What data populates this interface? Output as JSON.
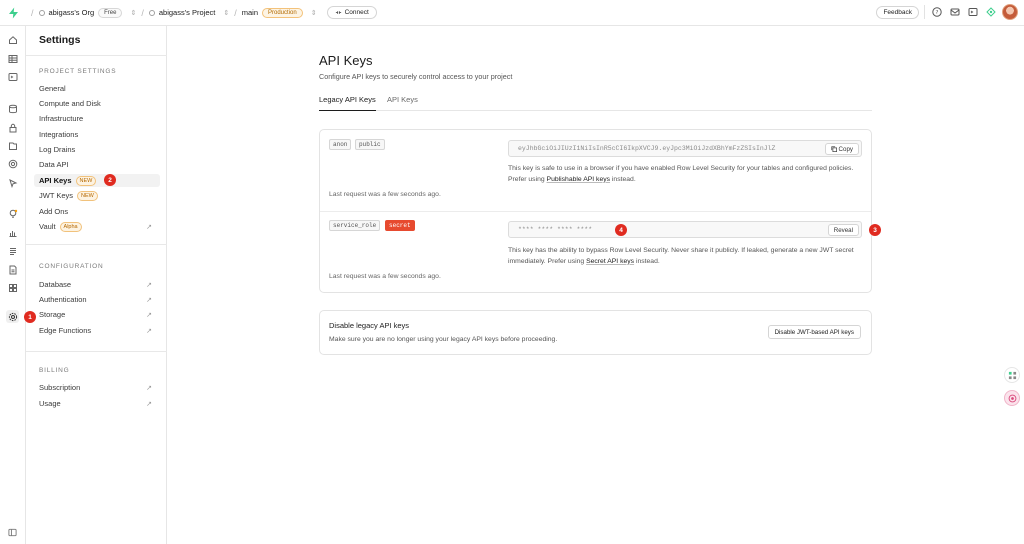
{
  "topbar": {
    "org_name": "abigass's Org",
    "org_plan": "Free",
    "project_name": "abigass's Project",
    "branch": "main",
    "branch_env": "Production",
    "connect_label": "Connect",
    "feedback_label": "Feedback"
  },
  "sidebar": {
    "title": "Settings",
    "project_settings_title": "PROJECT SETTINGS",
    "project_items": [
      {
        "label": "General"
      },
      {
        "label": "Compute and Disk"
      },
      {
        "label": "Infrastructure"
      },
      {
        "label": "Integrations"
      },
      {
        "label": "Log Drains"
      },
      {
        "label": "Data API"
      },
      {
        "label": "API Keys",
        "tag": "NEW"
      },
      {
        "label": "JWT Keys",
        "tag": "NEW"
      },
      {
        "label": "Add Ons"
      },
      {
        "label": "Vault",
        "tag": "Alpha"
      }
    ],
    "configuration_title": "CONFIGURATION",
    "configuration_items": [
      {
        "label": "Database"
      },
      {
        "label": "Authentication"
      },
      {
        "label": "Storage"
      },
      {
        "label": "Edge Functions"
      }
    ],
    "billing_title": "BILLING",
    "billing_items": [
      {
        "label": "Subscription"
      },
      {
        "label": "Usage"
      }
    ]
  },
  "markers": [
    "1",
    "2",
    "3",
    "4"
  ],
  "main": {
    "title": "API Keys",
    "subtitle": "Configure API keys to securely control access to your project",
    "tabs": [
      {
        "label": "Legacy API Keys"
      },
      {
        "label": "API Keys"
      }
    ],
    "anon": {
      "badge1": "anon",
      "badge2": "public",
      "key_value": "eyJhbGciOiJIUzI1NiIsInR5cCI6IkpXVCJ9.eyJpc3MiOiJzdXBhYmFzZSIsInJlZ",
      "copy_label": "Copy",
      "note_pre": "This key is safe to use in a browser if you have enabled Row Level Security for your tables and configured policies. Prefer using ",
      "note_link": "Publishable API keys",
      "note_post": " instead.",
      "last_request": "Last request was a few seconds ago."
    },
    "service": {
      "badge1": "service_role",
      "badge2": "secret",
      "key_value": "**** **** **** ****",
      "reveal_label": "Reveal",
      "note_pre": "This key has the ability to bypass Row Level Security. Never share it publicly. If leaked, generate a new JWT secret immediately. Prefer using ",
      "note_link": "Secret API keys",
      "note_post": " instead.",
      "last_request": "Last request was a few seconds ago."
    },
    "legacy": {
      "title": "Disable legacy API keys",
      "desc": "Make sure you are no longer using your legacy API keys before proceeding.",
      "button": "Disable JWT-based API keys"
    }
  },
  "colors": {
    "brand": "#3ecf8e",
    "marker": "#e02b20",
    "secret_badge": "#e74a2f"
  }
}
